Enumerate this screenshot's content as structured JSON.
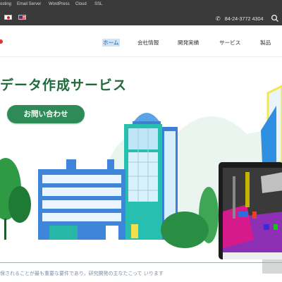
{
  "topbar": {
    "services": [
      "osting",
      "Email Server",
      "WordPress",
      "Cloud",
      "SSL"
    ],
    "phone": "84-24-3772 4304"
  },
  "nav": {
    "items": [
      "ホーム",
      "会社情報",
      "開発実績",
      "サービス",
      "製品"
    ],
    "active": "ホーム"
  },
  "hero": {
    "title": "データ作成サービス",
    "cta_label": "お問い合わせ"
  },
  "footer_text": "保されることが最も重要な要件であり，研究開発の主なたこって いります"
}
